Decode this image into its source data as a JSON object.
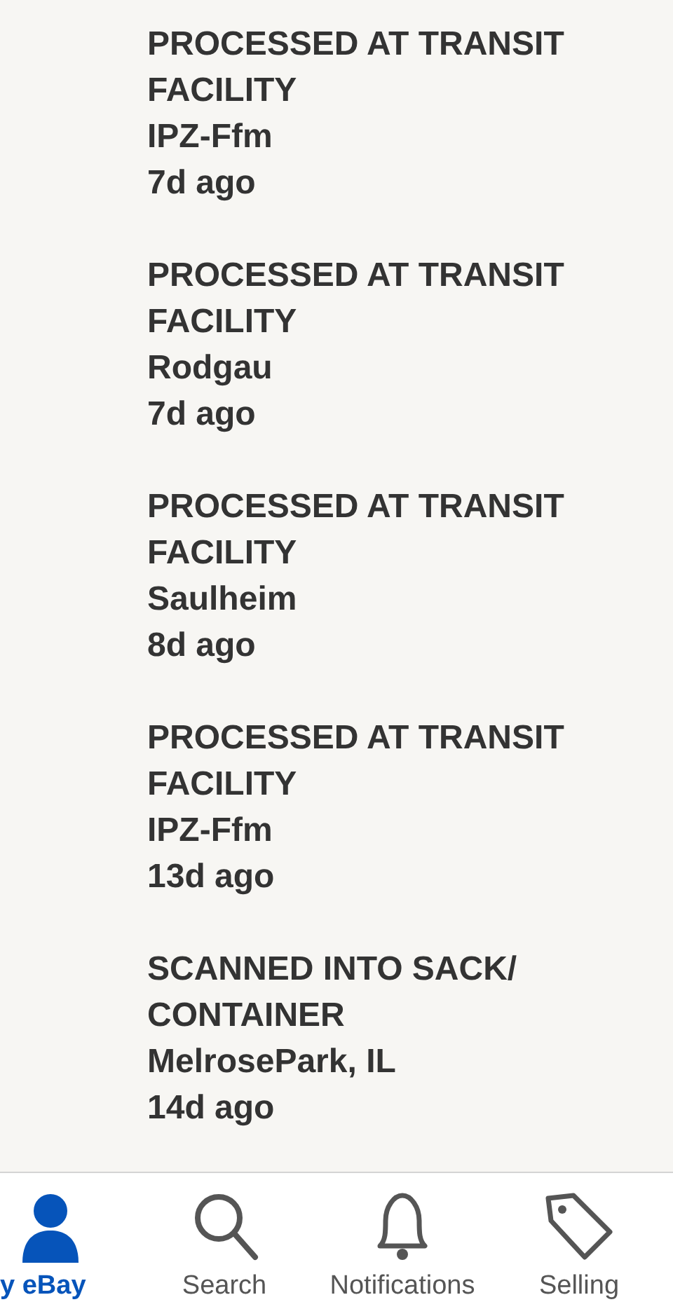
{
  "events": [
    {
      "status": "PROCESSED AT TRANSIT FACILITY",
      "location": "IPZ-Ffm",
      "time": "7d ago"
    },
    {
      "status": "PROCESSED AT TRANSIT FACILITY",
      "location": "Rodgau",
      "time": "7d ago"
    },
    {
      "status": "PROCESSED AT TRANSIT FACILITY",
      "location": "Saulheim",
      "time": "8d ago"
    },
    {
      "status": "PROCESSED AT TRANSIT FACILITY",
      "location": "IPZ-Ffm",
      "time": "13d ago"
    },
    {
      "status": "SCANNED INTO SACK/ CONTAINER",
      "location": "MelrosePark, IL",
      "time": "14d ago"
    }
  ],
  "tab_bar": [
    {
      "kind": "person",
      "label": "y eBay",
      "selected": true
    },
    {
      "kind": "search",
      "label": "Search",
      "selected": false
    },
    {
      "kind": "bell",
      "label": "Notifications",
      "selected": false
    },
    {
      "kind": "tag",
      "label": "Selling",
      "selected": false
    }
  ]
}
